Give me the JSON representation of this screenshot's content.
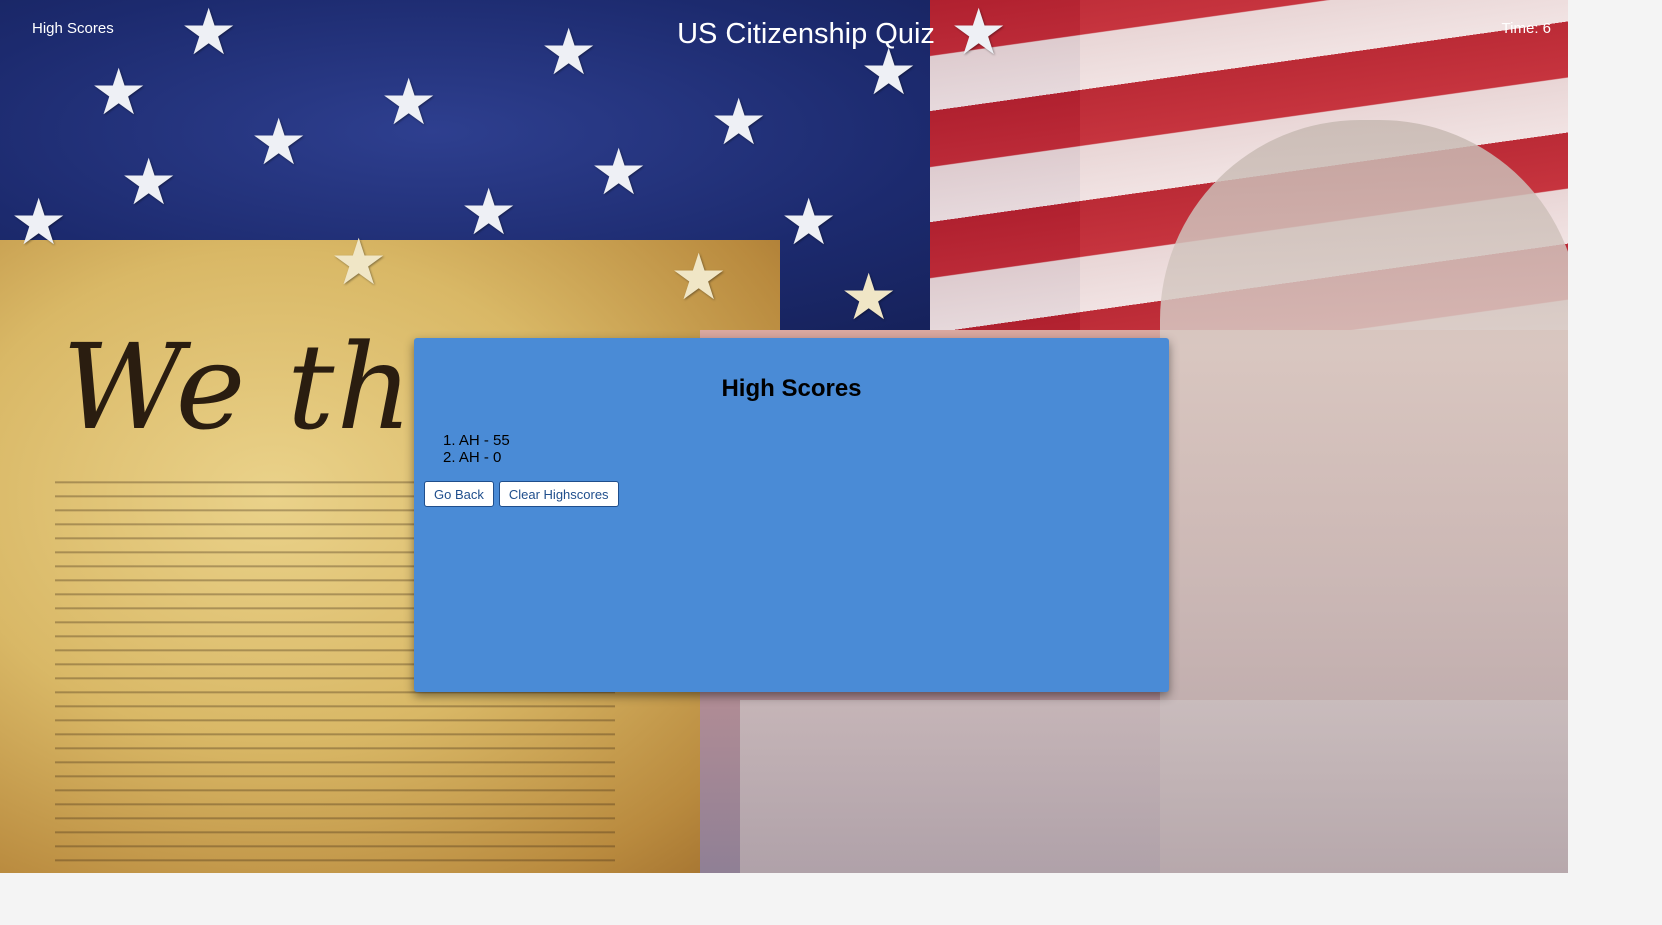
{
  "nav": {
    "highscores_link": "High Scores"
  },
  "header": {
    "title": "US Citizenship Quiz",
    "timer": "Time: 6"
  },
  "panel": {
    "heading": "High Scores",
    "scores": [
      {
        "rank": "1.",
        "entry": "AH - 55"
      },
      {
        "rank": "2.",
        "entry": "AH - 0"
      }
    ],
    "buttons": {
      "go_back": "Go Back",
      "clear": "Clear Highscores"
    }
  },
  "background": {
    "lettering": "We the Pe"
  },
  "colors": {
    "panel": "#4a8bd6",
    "button_text": "#1f4e8c",
    "header_text": "#ffffff"
  }
}
